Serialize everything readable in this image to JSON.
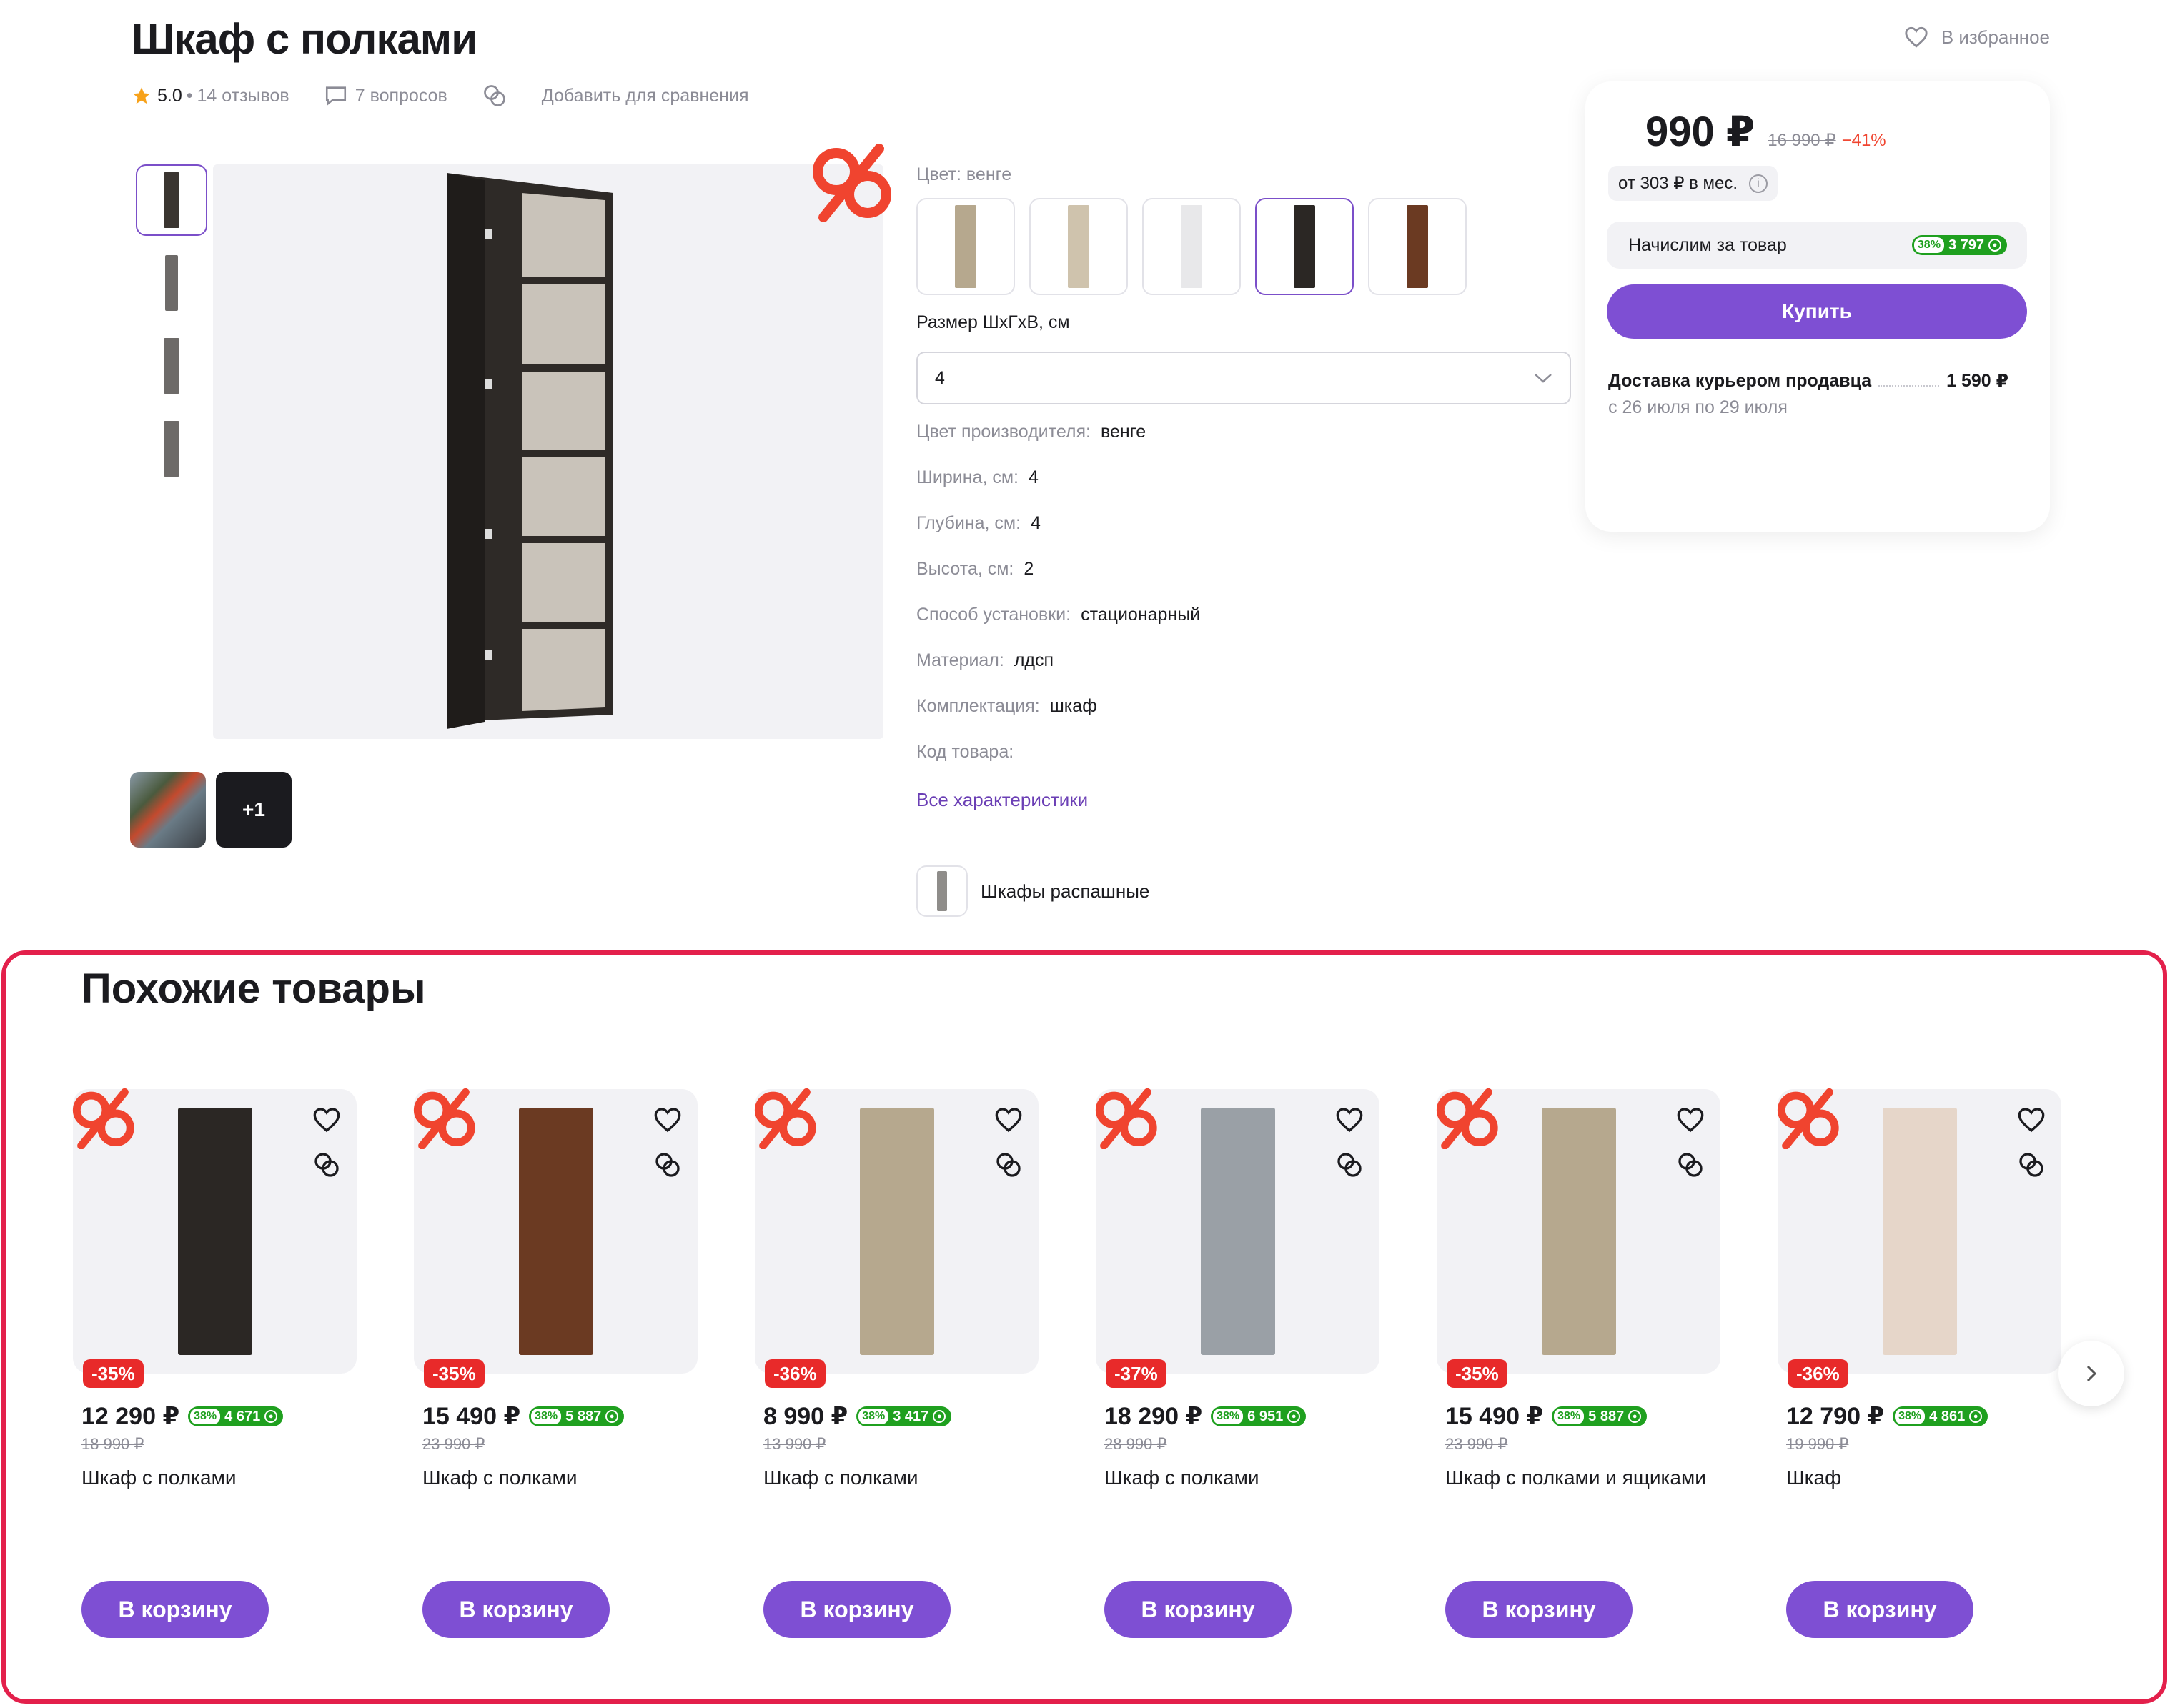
{
  "product": {
    "title": "Шкаф с полками",
    "favorite_label": "В избранное",
    "rating": "5.0",
    "reviews": "14 отзывов",
    "questions": "7 вопросов",
    "compare": "Добавить для сравнения"
  },
  "gallery": {
    "more_label": "+1"
  },
  "params": {
    "color_label": "Цвет: венге",
    "swatches": [
      {
        "name": "sonoma",
        "color": "#b6a88e"
      },
      {
        "name": "light",
        "color": "#cfc3ad"
      },
      {
        "name": "white",
        "color": "#e8e8ea"
      },
      {
        "name": "wenge",
        "color": "#2b2724"
      },
      {
        "name": "walnut",
        "color": "#6b3a22"
      }
    ],
    "size_label": "Размер ШхГхВ, см",
    "size_value": "4",
    "attributes": [
      {
        "k": "Цвет производителя:",
        "v": "венге"
      },
      {
        "k": "Ширина, см:",
        "v": "4"
      },
      {
        "k": "Глубина, см:",
        "v": "4"
      },
      {
        "k": "Высота, см:",
        "v": "2"
      },
      {
        "k": "Способ установки:",
        "v": "стационарный"
      },
      {
        "k": "Материал:",
        "v": "лдсп"
      },
      {
        "k": "Комплектация:",
        "v": "шкаф"
      },
      {
        "k": "Код товара:",
        "v": ""
      }
    ],
    "all_link": "Все характеристики",
    "category": "Шкафы распашные"
  },
  "buybox": {
    "price": "990 ₽",
    "old_price": "16 990 ₽",
    "discount": "−41%",
    "monthly": "от 303 ₽ в мес.",
    "cashback_label": "Начислим за товар",
    "cashback_pct": "38%",
    "cashback_value": "3 797",
    "buy_label": "Купить",
    "delivery_title": "Доставка курьером продавца",
    "delivery_price": "1 590 ₽",
    "delivery_dates": "с 26 июля по 29 июля"
  },
  "similar": {
    "title": "Похожие товары",
    "cart_label": "В корзину",
    "items": [
      {
        "discount": "-35%",
        "price": "12 290 ₽",
        "cb_pct": "38%",
        "cb": "4 671",
        "old": "18 990 ₽",
        "name": "Шкаф с полками",
        "color": "#2b2724"
      },
      {
        "discount": "-35%",
        "price": "15 490 ₽",
        "cb_pct": "38%",
        "cb": "5 887",
        "old": "23 990 ₽",
        "name": "Шкаф с полками",
        "color": "#6b3a22"
      },
      {
        "discount": "-36%",
        "price": "8 990 ₽",
        "cb_pct": "38%",
        "cb": "3 417",
        "old": "13 990 ₽",
        "name": "Шкаф с полками",
        "color": "#b6a88e"
      },
      {
        "discount": "-37%",
        "price": "18 290 ₽",
        "cb_pct": "38%",
        "cb": "6 951",
        "old": "28 990 ₽",
        "name": "Шкаф с полками",
        "color": "#9aa0a6"
      },
      {
        "discount": "-35%",
        "price": "15 490 ₽",
        "cb_pct": "38%",
        "cb": "5 887",
        "old": "23 990 ₽",
        "name": "Шкаф с полками и ящиками",
        "color": "#b6a88e"
      },
      {
        "discount": "-36%",
        "price": "12 790 ₽",
        "cb_pct": "38%",
        "cb": "4 861",
        "old": "19 990 ₽",
        "name": "Шкаф",
        "color": "#e6d6c9"
      }
    ]
  }
}
